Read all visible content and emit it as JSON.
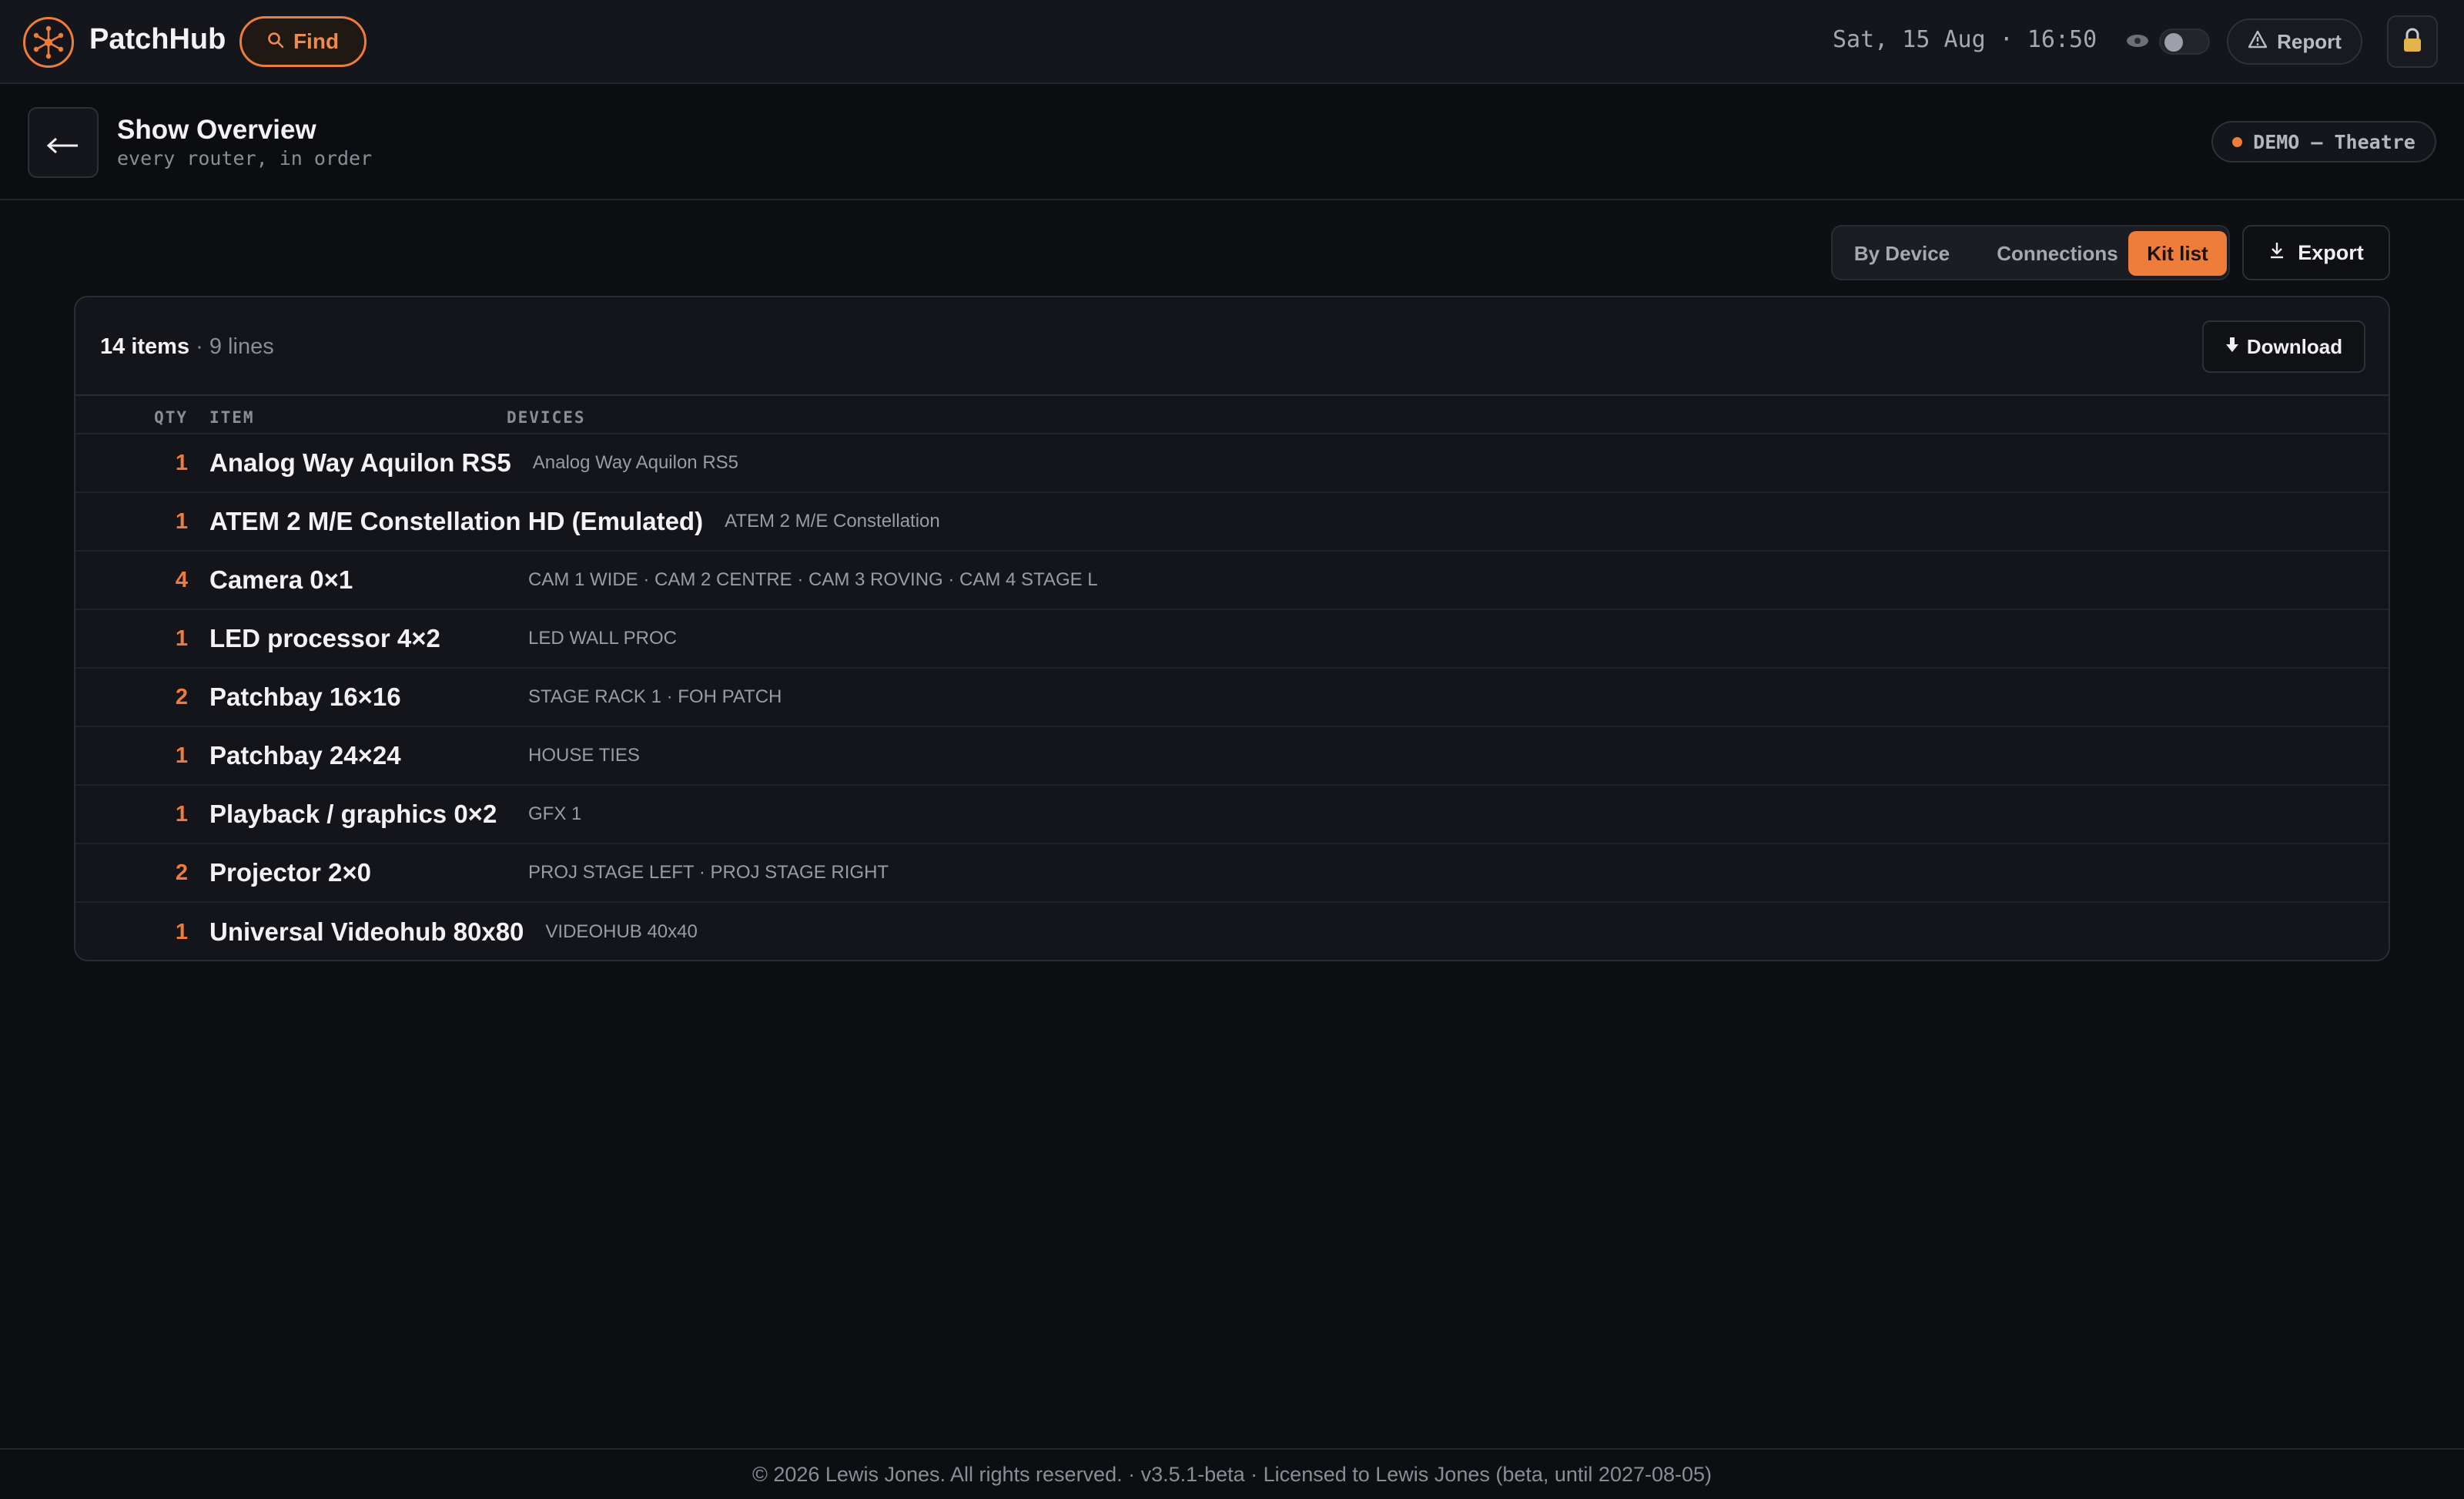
{
  "app": {
    "brand": "PatchHub",
    "find_label": "Find",
    "clock": "Sat, 15 Aug · 16:50",
    "report_label": "Report",
    "accent_color": "#ee7d3a"
  },
  "header": {
    "title": "Show Overview",
    "subtitle": "every router, in order",
    "badge": "DEMO — Theatre"
  },
  "view": {
    "tabs": [
      {
        "label": "By Device",
        "active": false
      },
      {
        "label": "Connections",
        "active": false
      },
      {
        "label": "Kit list",
        "active": true
      }
    ],
    "export_label": "Export"
  },
  "kit": {
    "item_count": "14 items",
    "separator": "·",
    "line_count": "9 lines",
    "download_label": "Download",
    "columns": {
      "qty": "QTY",
      "item": "ITEM",
      "devices": "DEVICES"
    },
    "rows": [
      {
        "qty": "1",
        "item": "Analog Way Aquilon RS5",
        "devices": "Analog Way Aquilon RS5"
      },
      {
        "qty": "1",
        "item": "ATEM 2 M/E Constellation HD (Emulated)",
        "devices": "ATEM 2 M/E Constellation"
      },
      {
        "qty": "4",
        "item": "Camera 0×1",
        "devices": "CAM 1 WIDE · CAM 2 CENTRE · CAM 3 ROVING · CAM 4 STAGE L"
      },
      {
        "qty": "1",
        "item": "LED processor 4×2",
        "devices": "LED WALL PROC"
      },
      {
        "qty": "2",
        "item": "Patchbay 16×16",
        "devices": "STAGE RACK 1 · FOH PATCH"
      },
      {
        "qty": "1",
        "item": "Patchbay 24×24",
        "devices": "HOUSE TIES"
      },
      {
        "qty": "1",
        "item": "Playback / graphics 0×2",
        "devices": "GFX 1"
      },
      {
        "qty": "2",
        "item": "Projector 2×0",
        "devices": "PROJ STAGE LEFT · PROJ STAGE RIGHT"
      },
      {
        "qty": "1",
        "item": "Universal Videohub 80x80",
        "devices": "VIDEOHUB 40x40"
      }
    ]
  },
  "footer": {
    "text": "© 2026 Lewis Jones. All rights reserved. · v3.5.1-beta · Licensed to Lewis Jones (beta, until 2027-08-05)"
  }
}
